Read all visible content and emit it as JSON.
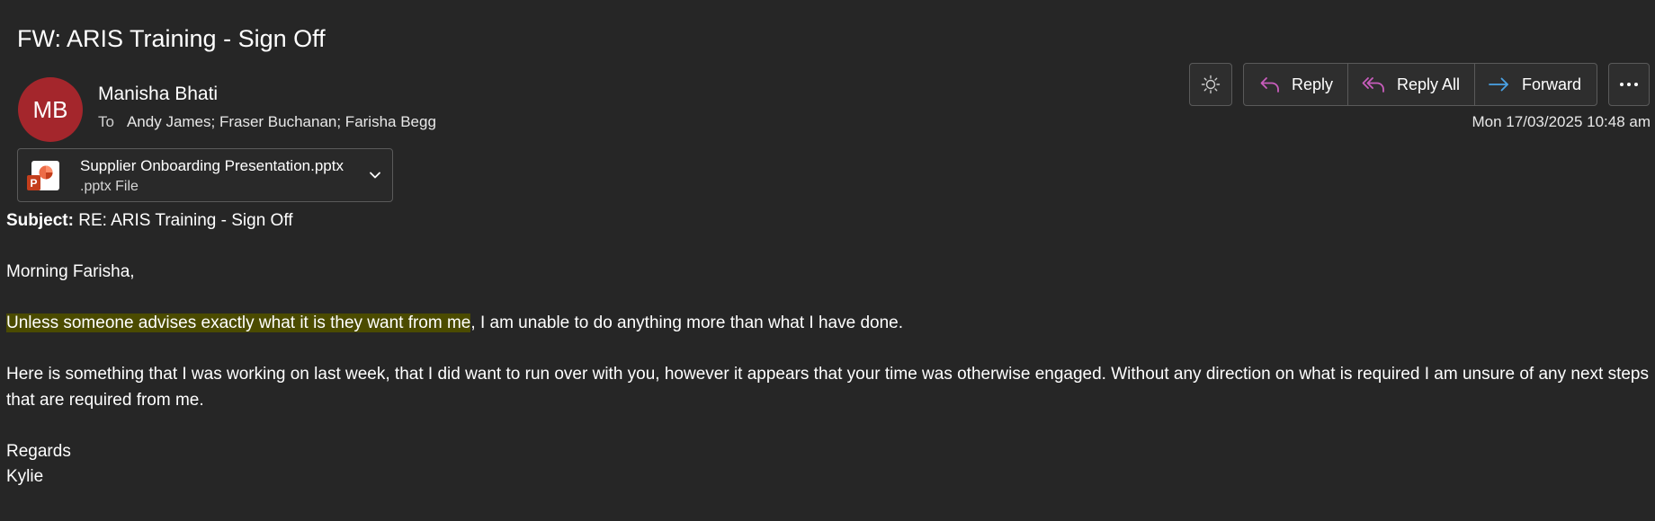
{
  "email": {
    "title": "FW: ARIS Training - Sign Off",
    "sender": {
      "initials": "MB",
      "name": "Manisha Bhati",
      "avatar_color": "#a4262c"
    },
    "recipients": {
      "to_label": "To",
      "names": "Andy James; Fraser Buchanan; Farisha Begg"
    },
    "timestamp": "Mon 17/03/2025 10:48 am",
    "attachment": {
      "file_name": "Supplier Onboarding Presentation.pptx",
      "file_type": ".pptx File",
      "icon": "powerpoint-file-icon",
      "icon_letter": "P"
    }
  },
  "toolbar": {
    "theme_icon": "sun-icon",
    "reply_label": "Reply",
    "reply_all_label": "Reply All",
    "forward_label": "Forward",
    "more_icon": "more-options-icon",
    "reply_icon_color": "#c95dbd",
    "forward_icon_color": "#4aa3e6"
  },
  "body": {
    "subject_label": "Subject:",
    "subject_value": " RE: ARIS Training - Sign Off",
    "greeting": "Morning Farisha,",
    "paragraph1_highlighted": "Unless someone advises exactly what it is they want from me",
    "paragraph1_rest": ", I am unable to do anything more than what I have done.",
    "paragraph2": "Here is something that I was working on last week, that I did want to run over with you, however it appears that your time was otherwise engaged. Without any direction on what is required I am unsure of any next steps that are required from me.",
    "signoff": "Regards",
    "signature": "Kylie",
    "highlight_color": "#4b4b00"
  }
}
